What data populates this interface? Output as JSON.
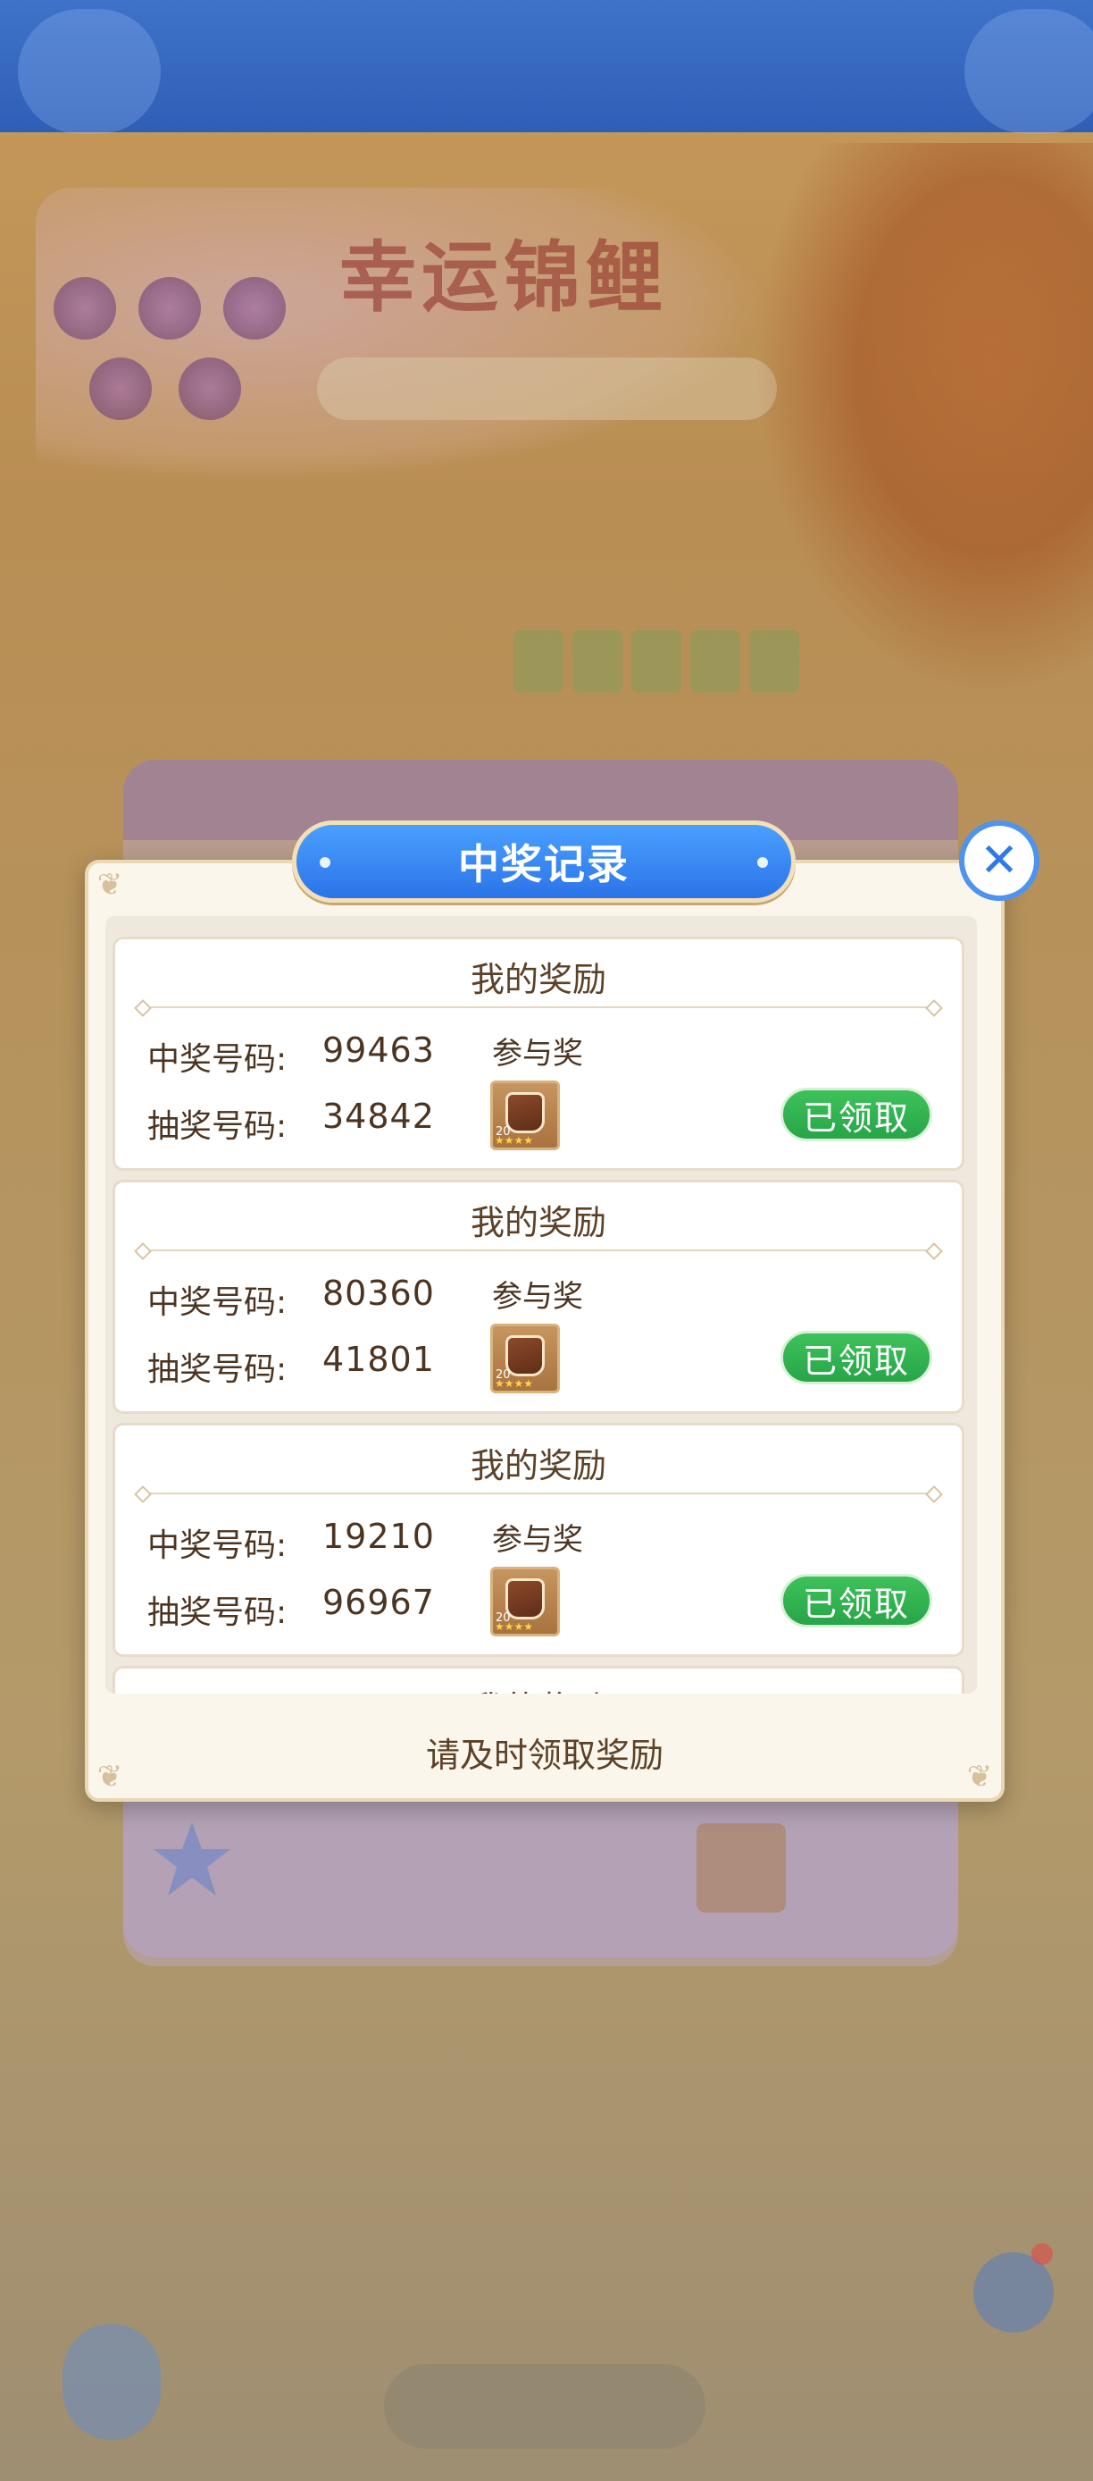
{
  "dialog": {
    "title": "中奖记录",
    "footer": "请及时领取奖励",
    "close_icon": "close-icon"
  },
  "records": [
    {
      "header": "我的奖励",
      "win_label": "中奖号码:",
      "win_number": "99463",
      "draw_label": "抽奖号码:",
      "draw_number": "34842",
      "prize": "参与奖",
      "item_level": "20",
      "status": "已领取"
    },
    {
      "header": "我的奖励",
      "win_label": "中奖号码:",
      "win_number": "80360",
      "draw_label": "抽奖号码:",
      "draw_number": "41801",
      "prize": "参与奖",
      "item_level": "20",
      "status": "已领取"
    },
    {
      "header": "我的奖励",
      "win_label": "中奖号码:",
      "win_number": "19210",
      "draw_label": "抽奖号码:",
      "draw_number": "96967",
      "prize": "参与奖",
      "item_level": "20",
      "status": "已领取"
    },
    {
      "header": "我的奖励"
    }
  ],
  "background": {
    "event_title": "幸运锦鲤"
  },
  "colors": {
    "title_tab": "#2b74e8",
    "claimed_button": "#27a548",
    "dialog_bg": "#fbf6ec",
    "text": "#4b3422"
  }
}
